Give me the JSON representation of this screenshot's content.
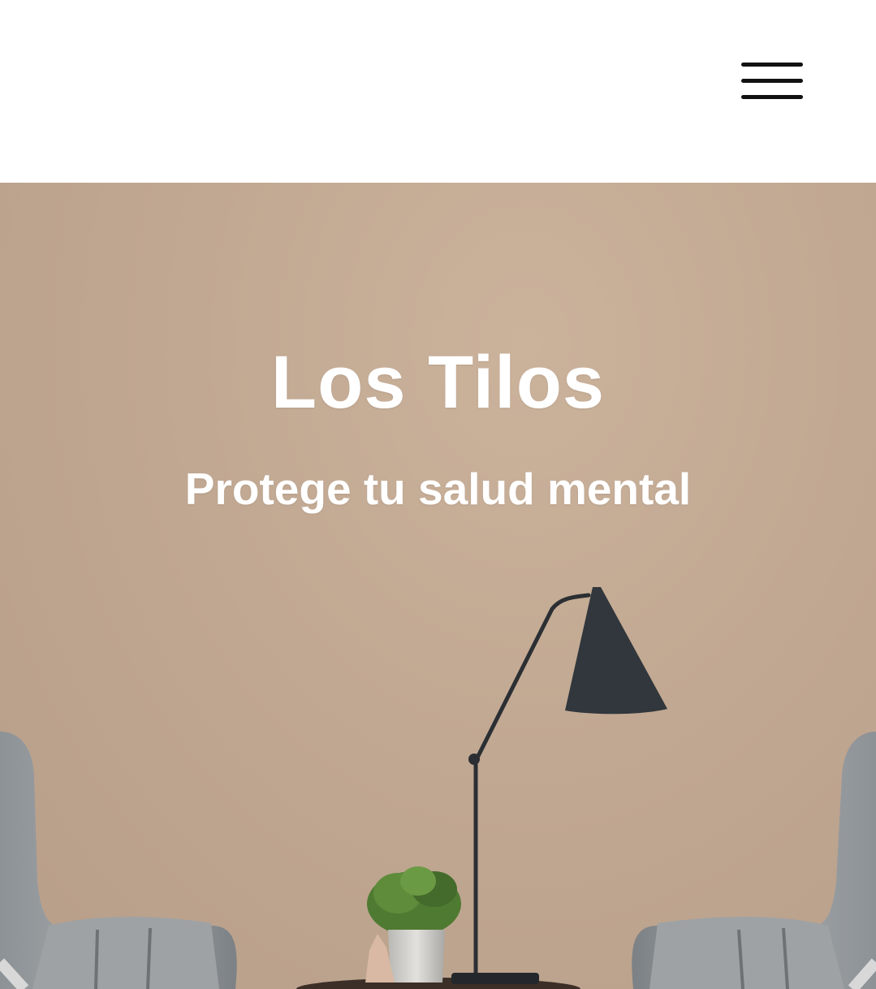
{
  "header": {
    "menu_icon": "hamburger-menu-icon"
  },
  "hero": {
    "title": "Los Tilos",
    "subtitle": "Protege tu salud mental"
  },
  "colors": {
    "header_background": "#ffffff",
    "hero_background": "#c1a892",
    "text": "#ffffff",
    "menu_icon": "#111111"
  }
}
